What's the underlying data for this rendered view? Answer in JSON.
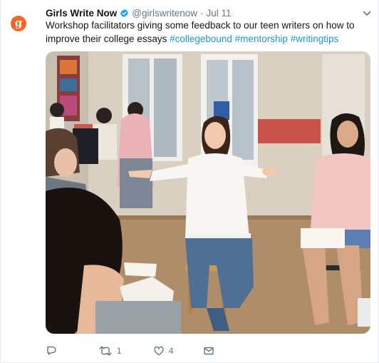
{
  "tweet": {
    "author_name": "Girls Write Now",
    "handle": "@girlswritenow",
    "separator": "·",
    "date": "Jul 11",
    "avatar_letter": "g",
    "text": "Workshop facilitators giving some feedback to our teen writers on how to improve their college essays ",
    "hashtags": [
      "#collegebound",
      "#mentorship",
      "#writingtips"
    ],
    "image_description": "Workshop facilitators giving feedback to teen writers in a circle of chairs"
  },
  "actions": {
    "reply_icon": "reply-icon",
    "retweet_icon": "retweet-icon",
    "retweet_count": "1",
    "like_icon": "heart-icon",
    "like_count": "4",
    "dm_icon": "envelope-icon"
  },
  "colors": {
    "brand_orange": "#f26522",
    "link_blue": "#1b95e0",
    "muted": "#657786",
    "verified": "#1da1f2"
  }
}
